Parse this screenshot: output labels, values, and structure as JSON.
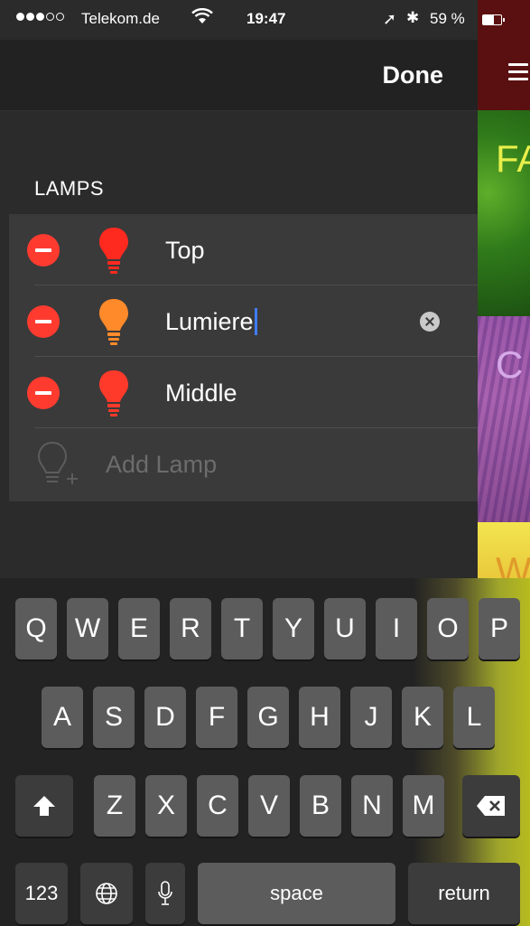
{
  "status_bar": {
    "carrier": "Telekom.de",
    "time": "19:47",
    "battery": "59 %"
  },
  "navbar": {
    "done_label": "Done"
  },
  "peek": {
    "tile1_text": "FA",
    "tile2_text": "C",
    "tile3_text": "W"
  },
  "section": {
    "title": "LAMPS"
  },
  "lamps": [
    {
      "name": "Top",
      "color": "#ff2a1f"
    },
    {
      "name": "Lumiere",
      "color": "#ff8a2a"
    },
    {
      "name": "Middle",
      "color": "#ff3a2a"
    }
  ],
  "add_lamp": {
    "label": "Add Lamp"
  },
  "keyboard": {
    "row1": [
      "Q",
      "W",
      "E",
      "R",
      "T",
      "Y",
      "U",
      "I",
      "O",
      "P"
    ],
    "row2": [
      "A",
      "S",
      "D",
      "F",
      "G",
      "H",
      "J",
      "K",
      "L"
    ],
    "row3": [
      "Z",
      "X",
      "C",
      "V",
      "B",
      "N",
      "M"
    ],
    "numbers_label": "123",
    "space_label": "space",
    "return_label": "return"
  }
}
